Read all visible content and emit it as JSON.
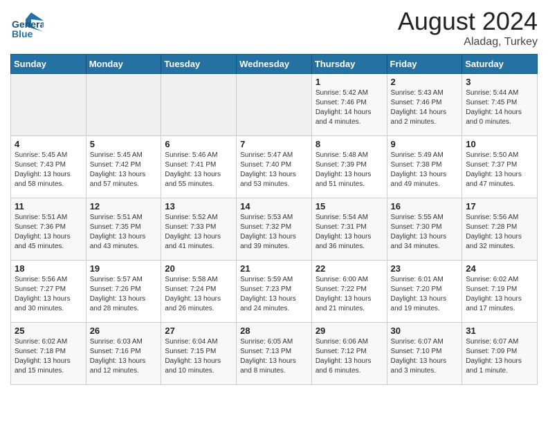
{
  "header": {
    "logo_line1": "General",
    "logo_line2": "Blue",
    "title": "August 2024",
    "subtitle": "Aladag, Turkey"
  },
  "days_of_week": [
    "Sunday",
    "Monday",
    "Tuesday",
    "Wednesday",
    "Thursday",
    "Friday",
    "Saturday"
  ],
  "weeks": [
    [
      {
        "day": "",
        "empty": true
      },
      {
        "day": "",
        "empty": true
      },
      {
        "day": "",
        "empty": true
      },
      {
        "day": "",
        "empty": true
      },
      {
        "day": "1",
        "sunrise": "Sunrise: 5:42 AM",
        "sunset": "Sunset: 7:46 PM",
        "daylight": "Daylight: 14 hours and 4 minutes."
      },
      {
        "day": "2",
        "sunrise": "Sunrise: 5:43 AM",
        "sunset": "Sunset: 7:46 PM",
        "daylight": "Daylight: 14 hours and 2 minutes."
      },
      {
        "day": "3",
        "sunrise": "Sunrise: 5:44 AM",
        "sunset": "Sunset: 7:45 PM",
        "daylight": "Daylight: 14 hours and 0 minutes."
      }
    ],
    [
      {
        "day": "4",
        "sunrise": "Sunrise: 5:45 AM",
        "sunset": "Sunset: 7:43 PM",
        "daylight": "Daylight: 13 hours and 58 minutes."
      },
      {
        "day": "5",
        "sunrise": "Sunrise: 5:45 AM",
        "sunset": "Sunset: 7:42 PM",
        "daylight": "Daylight: 13 hours and 57 minutes."
      },
      {
        "day": "6",
        "sunrise": "Sunrise: 5:46 AM",
        "sunset": "Sunset: 7:41 PM",
        "daylight": "Daylight: 13 hours and 55 minutes."
      },
      {
        "day": "7",
        "sunrise": "Sunrise: 5:47 AM",
        "sunset": "Sunset: 7:40 PM",
        "daylight": "Daylight: 13 hours and 53 minutes."
      },
      {
        "day": "8",
        "sunrise": "Sunrise: 5:48 AM",
        "sunset": "Sunset: 7:39 PM",
        "daylight": "Daylight: 13 hours and 51 minutes."
      },
      {
        "day": "9",
        "sunrise": "Sunrise: 5:49 AM",
        "sunset": "Sunset: 7:38 PM",
        "daylight": "Daylight: 13 hours and 49 minutes."
      },
      {
        "day": "10",
        "sunrise": "Sunrise: 5:50 AM",
        "sunset": "Sunset: 7:37 PM",
        "daylight": "Daylight: 13 hours and 47 minutes."
      }
    ],
    [
      {
        "day": "11",
        "sunrise": "Sunrise: 5:51 AM",
        "sunset": "Sunset: 7:36 PM",
        "daylight": "Daylight: 13 hours and 45 minutes."
      },
      {
        "day": "12",
        "sunrise": "Sunrise: 5:51 AM",
        "sunset": "Sunset: 7:35 PM",
        "daylight": "Daylight: 13 hours and 43 minutes."
      },
      {
        "day": "13",
        "sunrise": "Sunrise: 5:52 AM",
        "sunset": "Sunset: 7:33 PM",
        "daylight": "Daylight: 13 hours and 41 minutes."
      },
      {
        "day": "14",
        "sunrise": "Sunrise: 5:53 AM",
        "sunset": "Sunset: 7:32 PM",
        "daylight": "Daylight: 13 hours and 39 minutes."
      },
      {
        "day": "15",
        "sunrise": "Sunrise: 5:54 AM",
        "sunset": "Sunset: 7:31 PM",
        "daylight": "Daylight: 13 hours and 36 minutes."
      },
      {
        "day": "16",
        "sunrise": "Sunrise: 5:55 AM",
        "sunset": "Sunset: 7:30 PM",
        "daylight": "Daylight: 13 hours and 34 minutes."
      },
      {
        "day": "17",
        "sunrise": "Sunrise: 5:56 AM",
        "sunset": "Sunset: 7:28 PM",
        "daylight": "Daylight: 13 hours and 32 minutes."
      }
    ],
    [
      {
        "day": "18",
        "sunrise": "Sunrise: 5:56 AM",
        "sunset": "Sunset: 7:27 PM",
        "daylight": "Daylight: 13 hours and 30 minutes."
      },
      {
        "day": "19",
        "sunrise": "Sunrise: 5:57 AM",
        "sunset": "Sunset: 7:26 PM",
        "daylight": "Daylight: 13 hours and 28 minutes."
      },
      {
        "day": "20",
        "sunrise": "Sunrise: 5:58 AM",
        "sunset": "Sunset: 7:24 PM",
        "daylight": "Daylight: 13 hours and 26 minutes."
      },
      {
        "day": "21",
        "sunrise": "Sunrise: 5:59 AM",
        "sunset": "Sunset: 7:23 PM",
        "daylight": "Daylight: 13 hours and 24 minutes."
      },
      {
        "day": "22",
        "sunrise": "Sunrise: 6:00 AM",
        "sunset": "Sunset: 7:22 PM",
        "daylight": "Daylight: 13 hours and 21 minutes."
      },
      {
        "day": "23",
        "sunrise": "Sunrise: 6:01 AM",
        "sunset": "Sunset: 7:20 PM",
        "daylight": "Daylight: 13 hours and 19 minutes."
      },
      {
        "day": "24",
        "sunrise": "Sunrise: 6:02 AM",
        "sunset": "Sunset: 7:19 PM",
        "daylight": "Daylight: 13 hours and 17 minutes."
      }
    ],
    [
      {
        "day": "25",
        "sunrise": "Sunrise: 6:02 AM",
        "sunset": "Sunset: 7:18 PM",
        "daylight": "Daylight: 13 hours and 15 minutes."
      },
      {
        "day": "26",
        "sunrise": "Sunrise: 6:03 AM",
        "sunset": "Sunset: 7:16 PM",
        "daylight": "Daylight: 13 hours and 12 minutes."
      },
      {
        "day": "27",
        "sunrise": "Sunrise: 6:04 AM",
        "sunset": "Sunset: 7:15 PM",
        "daylight": "Daylight: 13 hours and 10 minutes."
      },
      {
        "day": "28",
        "sunrise": "Sunrise: 6:05 AM",
        "sunset": "Sunset: 7:13 PM",
        "daylight": "Daylight: 13 hours and 8 minutes."
      },
      {
        "day": "29",
        "sunrise": "Sunrise: 6:06 AM",
        "sunset": "Sunset: 7:12 PM",
        "daylight": "Daylight: 13 hours and 6 minutes."
      },
      {
        "day": "30",
        "sunrise": "Sunrise: 6:07 AM",
        "sunset": "Sunset: 7:10 PM",
        "daylight": "Daylight: 13 hours and 3 minutes."
      },
      {
        "day": "31",
        "sunrise": "Sunrise: 6:07 AM",
        "sunset": "Sunset: 7:09 PM",
        "daylight": "Daylight: 13 hours and 1 minute."
      }
    ]
  ]
}
